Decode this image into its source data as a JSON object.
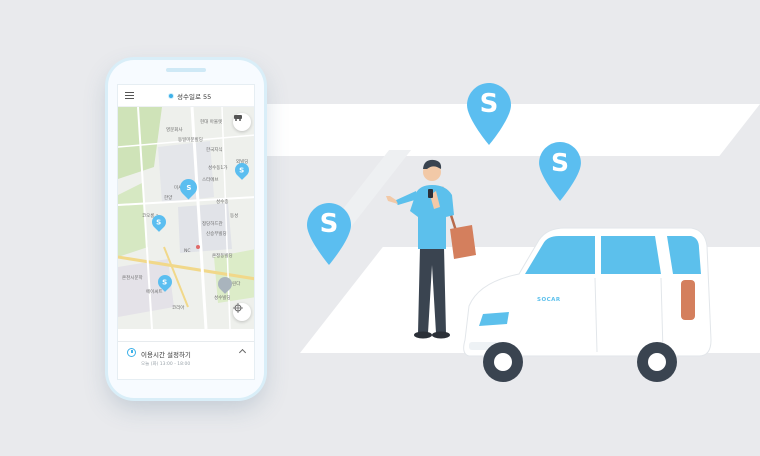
{
  "app": {
    "header": {
      "location": "성수일로 55"
    },
    "map_labels": [
      "현대 아울렛",
      "영문회사",
      "동일미문빌딩",
      "한국지식",
      "외빌딩",
      "성수동1가",
      "스터에브",
      "미서비스",
      "한양",
      "코오롱 a",
      "성수종",
      "동성",
      "정당하드관",
      "신승무빌딩",
      "NC",
      "온정동빌딩",
      "온천시문학",
      "에이씨트",
      "코리아",
      "성수빌딩",
      "그린다"
    ],
    "pins": [
      "S",
      "S",
      "S",
      "S"
    ],
    "bottom_panel": {
      "title": "이용시간 설정하기",
      "subtitle": "오늘 (화) 13:00 - 18:00"
    }
  },
  "illustration": {
    "pins": [
      "S",
      "S",
      "S"
    ],
    "car_brand": "SOCAR"
  },
  "colors": {
    "brand_blue": "#5bbef0",
    "background": "#e9eaed",
    "shirt": "#5cc0ec",
    "pants": "#3a4450",
    "bag": "#d47f5d"
  }
}
